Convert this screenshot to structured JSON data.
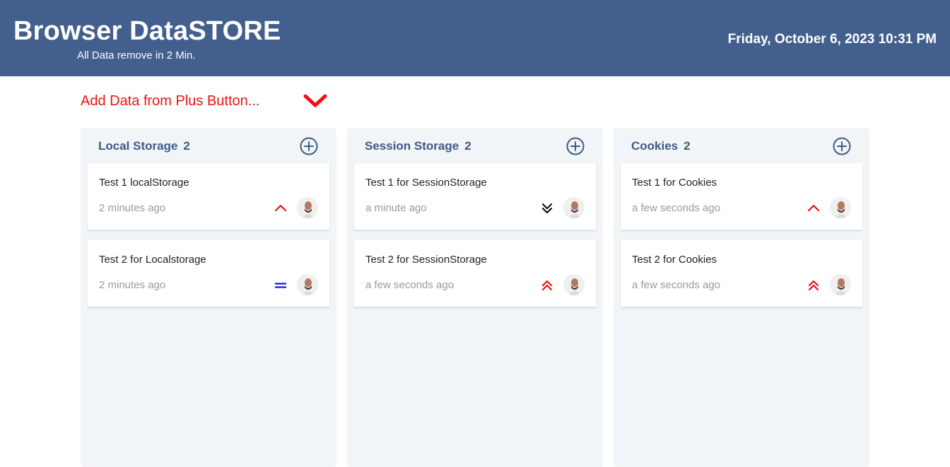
{
  "header": {
    "title": "Browser DataSTORE",
    "subtitle": "All Data remove in 2 Min.",
    "datetime": "Friday, October 6, 2023 10:31 PM"
  },
  "hint": {
    "text": "Add Data from Plus Button..."
  },
  "columns": [
    {
      "title": "Local Storage",
      "count": "2",
      "cards": [
        {
          "title": "Test 1 localStorage",
          "time": "2 minutes ago",
          "priority_icon": "chevron-up-icon",
          "priority_color": "#ee1111"
        },
        {
          "title": "Test 2 for Localstorage",
          "time": "2 minutes ago",
          "priority_icon": "equals-icon",
          "priority_color": "#2222dd"
        }
      ]
    },
    {
      "title": "Session Storage",
      "count": "2",
      "cards": [
        {
          "title": "Test 1 for SessionStorage",
          "time": "a minute ago",
          "priority_icon": "double-chevron-down-icon",
          "priority_color": "#111111"
        },
        {
          "title": "Test 2 for SessionStorage",
          "time": "a few seconds ago",
          "priority_icon": "double-chevron-up-icon",
          "priority_color": "#ee1111"
        }
      ]
    },
    {
      "title": "Cookies",
      "count": "2",
      "cards": [
        {
          "title": "Test 1 for Cookies",
          "time": "a few seconds ago",
          "priority_icon": "chevron-up-icon",
          "priority_color": "#ee1111"
        },
        {
          "title": "Test 2 for Cookies",
          "time": "a few seconds ago",
          "priority_icon": "double-chevron-up-icon",
          "priority_color": "#ee1111"
        }
      ]
    }
  ],
  "colors": {
    "header_bg": "#425f8d",
    "accent_text": "#3c5a87",
    "hint_red": "#ee1111",
    "column_bg": "#f2f5f8"
  }
}
